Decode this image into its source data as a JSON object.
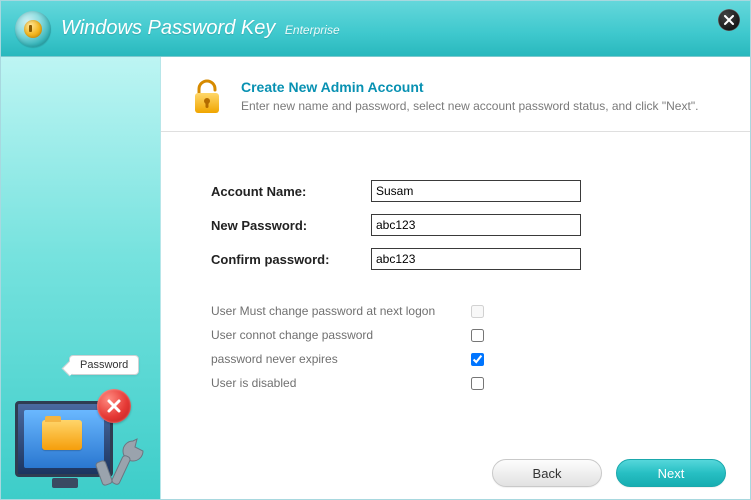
{
  "header": {
    "title": "Windows Password Key",
    "edition": "Enterprise"
  },
  "sidebar": {
    "pill_text": "Password"
  },
  "intro": {
    "heading": "Create New Admin Account",
    "subheading": "Enter new name and password, select new account password status, and click \"Next\"."
  },
  "form": {
    "account_name": {
      "label": "Account Name:",
      "value": "Susam"
    },
    "new_password": {
      "label": "New Password:",
      "value": "abc123"
    },
    "confirm_password": {
      "label": "Confirm password:",
      "value": "abc123"
    }
  },
  "options": [
    {
      "label": "User Must change password at next logon",
      "checked": false,
      "disabled": true
    },
    {
      "label": "User connot change password",
      "checked": false,
      "disabled": false
    },
    {
      "label": "password never expires",
      "checked": true,
      "disabled": false
    },
    {
      "label": "User is disabled",
      "checked": false,
      "disabled": false
    }
  ],
  "footer": {
    "back": "Back",
    "next": "Next"
  }
}
